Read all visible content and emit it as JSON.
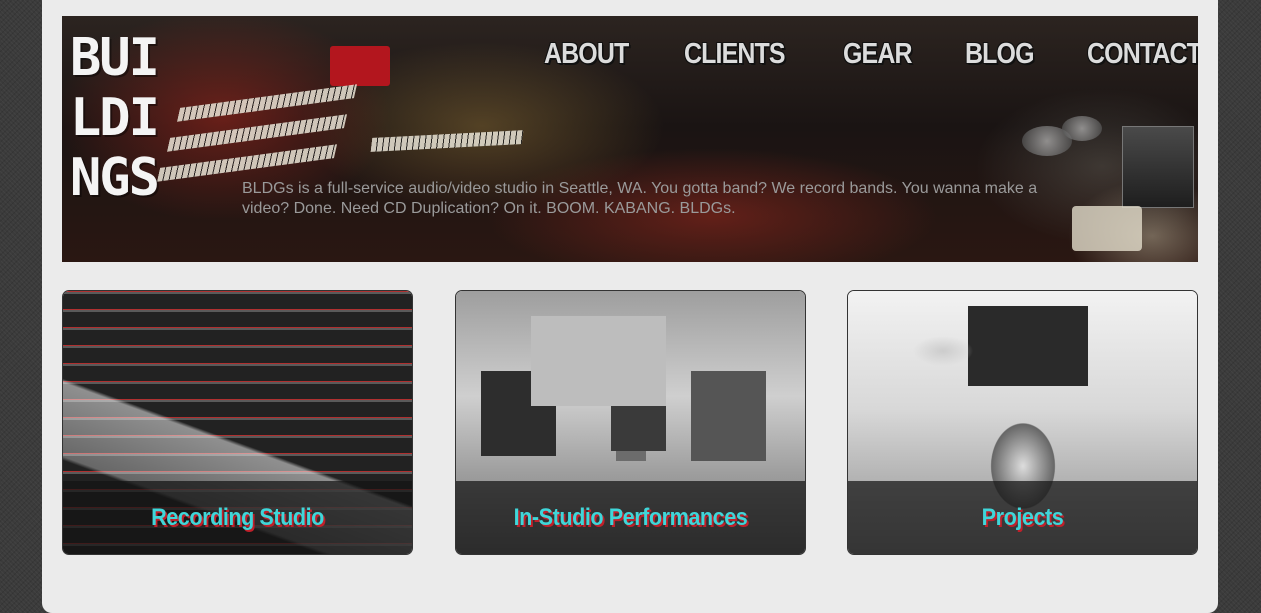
{
  "brand": {
    "logo_lines": [
      "BUI",
      "LDI",
      "NGS"
    ]
  },
  "nav": {
    "items": [
      {
        "label": "ABOUT"
      },
      {
        "label": "CLIENTS"
      },
      {
        "label": "GEAR"
      },
      {
        "label": "BLOG"
      },
      {
        "label": "CONTACT"
      }
    ]
  },
  "hero": {
    "tagline": "BLDGs is a full-service audio/video studio in Seattle, WA. You gotta band? We record bands. You wanna make a video? Done. Need CD Duplication? On it. BOOM. KABANG. BLDGs."
  },
  "cards": [
    {
      "label": "Recording Studio"
    },
    {
      "label": "In-Studio Performances"
    },
    {
      "label": "Projects"
    }
  ],
  "colors": {
    "page_background": "#3b3b3b",
    "content_background": "#ebebeb",
    "caption_text": "#3fd6d9",
    "caption_shadow": "#c0202a",
    "nav_text": "#dcdcdc",
    "tagline_text": "#9a9a9a"
  }
}
